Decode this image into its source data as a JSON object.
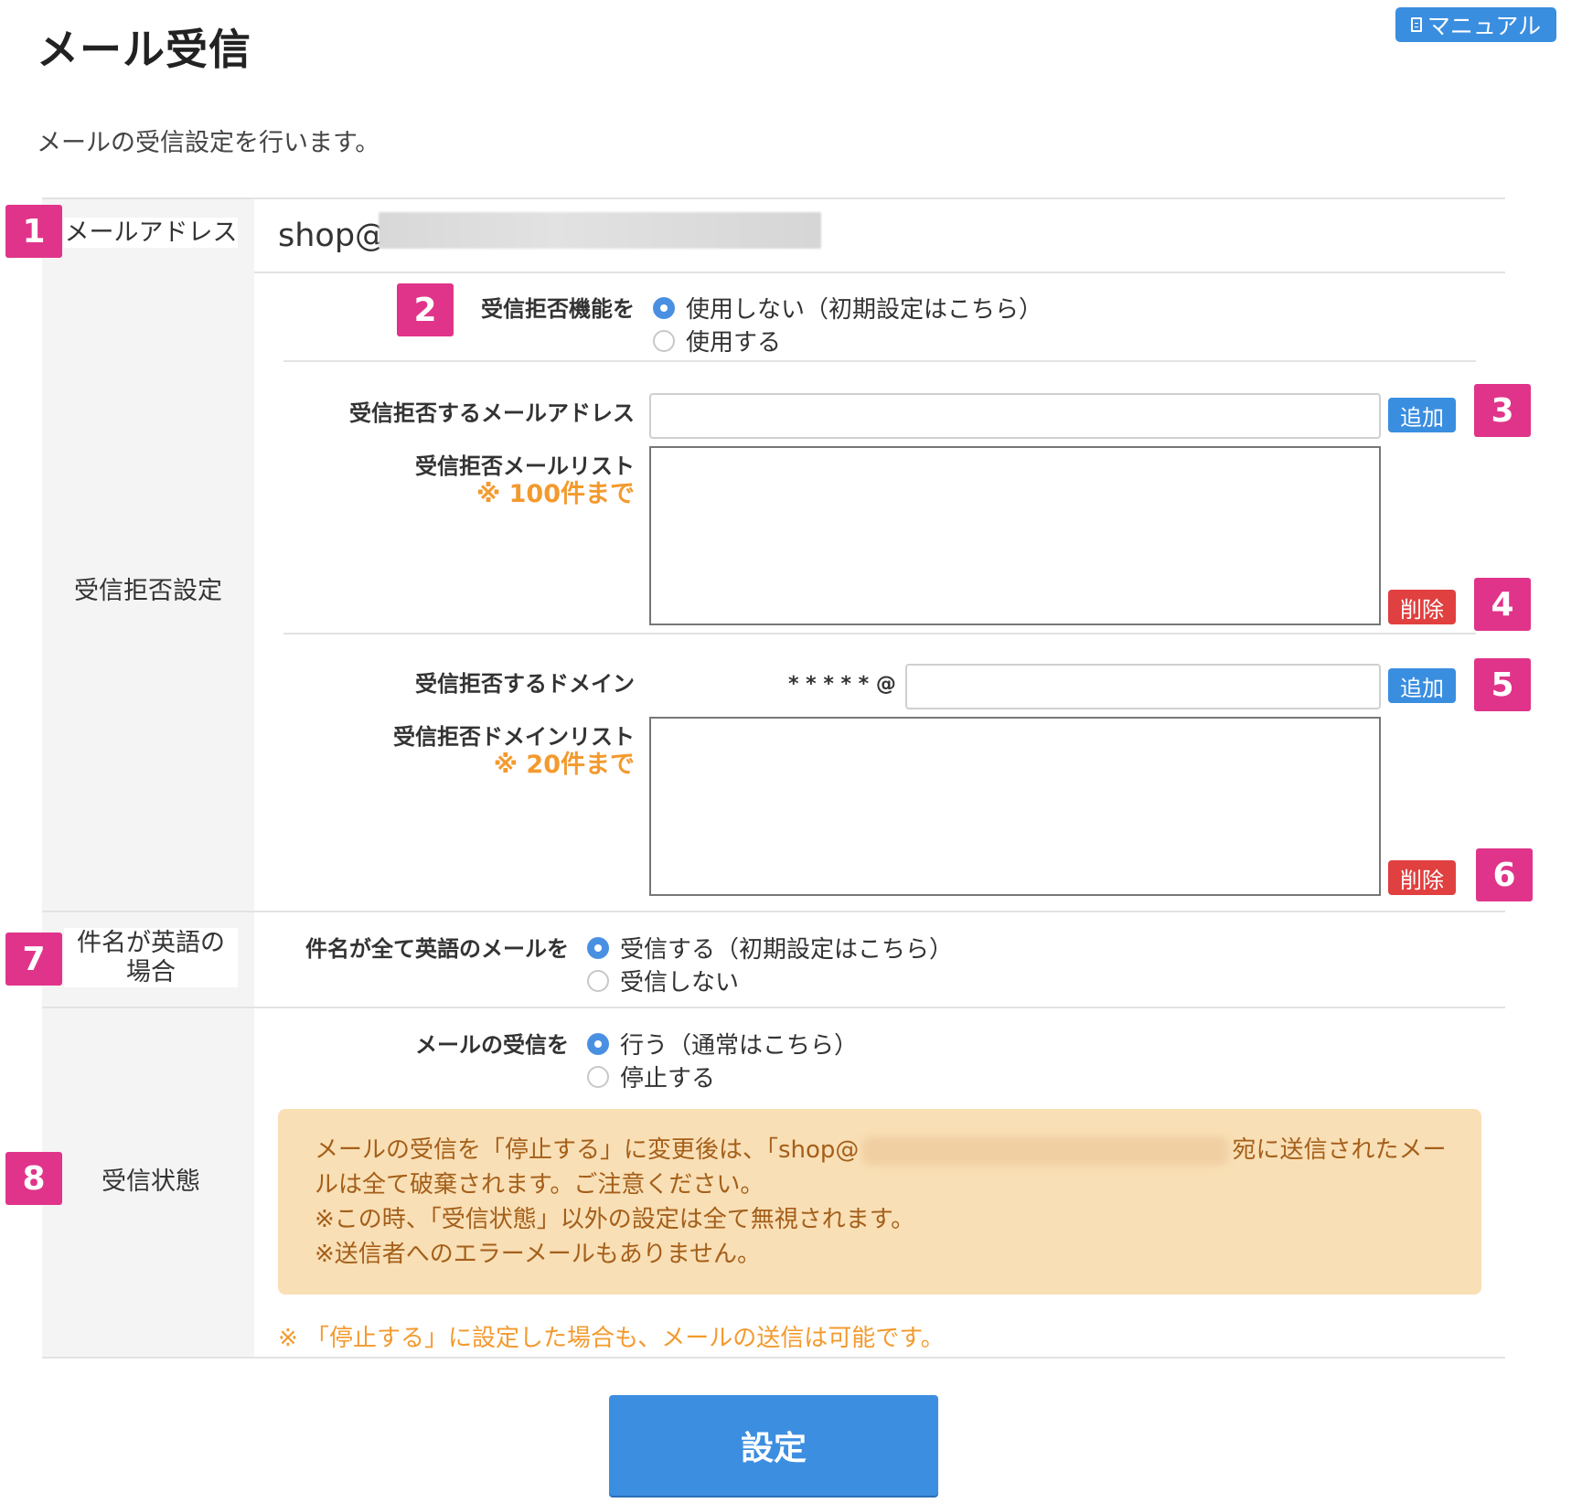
{
  "header": {
    "title": "メール受信",
    "manual_label": "マニュアル",
    "description": "メールの受信設定を行います。"
  },
  "email_row": {
    "badge": "1",
    "label": "メールアドレス",
    "value": "shop@"
  },
  "reject_section": {
    "label": "受信拒否設定",
    "function": {
      "badge": "2",
      "label": "受信拒否機能を",
      "options": [
        "使用しない（初期設定はこちら）",
        "使用する"
      ],
      "selected": 0
    },
    "address": {
      "badge_add": "3",
      "input_label": "受信拒否するメールアドレス",
      "input_value": "",
      "add_label": "追加",
      "list_label": "受信拒否メールリスト",
      "list_note": "※ 100件まで",
      "badge_delete": "4",
      "delete_label": "削除"
    },
    "domain": {
      "badge_add": "5",
      "input_label": "受信拒否するドメイン",
      "prefix": "* * * * * @",
      "input_value": "",
      "add_label": "追加",
      "list_label": "受信拒否ドメインリスト",
      "list_note": "※ 20件まで",
      "badge_delete": "6",
      "delete_label": "削除"
    }
  },
  "english_subject": {
    "badge": "7",
    "label_line1": "件名が英語の",
    "label_line2": "場合",
    "field_label": "件名が全て英語のメールを",
    "options": [
      "受信する（初期設定はこちら）",
      "受信しない"
    ],
    "selected": 0
  },
  "receive_status": {
    "badge": "8",
    "label": "受信状態",
    "field_label": "メールの受信を",
    "options": [
      "行う（通常はこちら）",
      "停止する"
    ],
    "selected": 0,
    "warning": {
      "line1_start": "メールの受信を「停止する」に変更後は、「shop@",
      "line1_end": "宛に送信されたメー",
      "line2": "ルは全て破棄されます。ご注意ください。",
      "line3": "※この時、「受信状態」以外の設定は全て無視されます。",
      "line4": "※送信者へのエラーメールもありません。"
    },
    "footnote": "※ 「停止する」に設定した場合も、メールの送信は可能です。"
  },
  "submit_label": "設定",
  "colors": {
    "primary_blue": "#3a8ee0",
    "danger_red": "#e04040",
    "badge_pink": "#e0348a",
    "note_orange": "#f39a2e",
    "warning_bg": "#f9dfb5",
    "warning_text": "#a45f1a"
  }
}
